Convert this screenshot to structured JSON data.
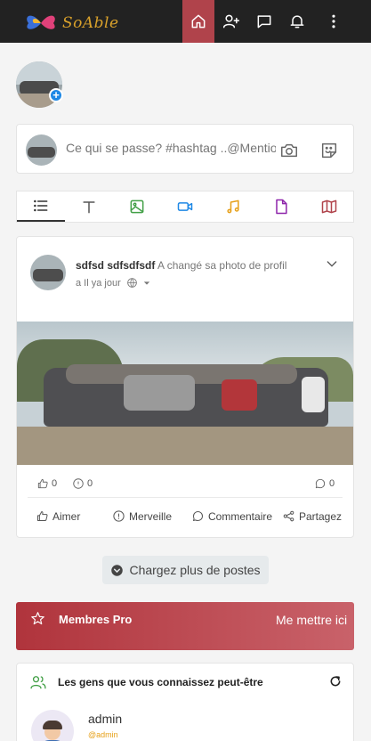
{
  "app": {
    "logo_text": "SoAble"
  },
  "composer": {
    "placeholder": "Ce qui se passe? #hashtag ..@Mentio"
  },
  "post": {
    "author": "sdfsd sdfsdfsdf",
    "action": "A changé sa photo de profil",
    "time": "a Il ya jour",
    "like_count": "0",
    "wonder_count": "0",
    "comment_count": "0",
    "like_label": "Aimer",
    "wonder_label": "Merveille",
    "comment_label": "Commentaire",
    "share_label": "Partagez"
  },
  "load_more": "Chargez plus de postes",
  "pro": {
    "title": "Membres Pro",
    "cta": "Me mettre ici"
  },
  "suggest": {
    "title": "Les gens que vous connaissez peut-être",
    "user_name": "admin",
    "user_handle": "@admin"
  },
  "colors": {
    "topbar": "#222222",
    "accent": "#b0434b",
    "load_more_bg": "#e6eaec"
  },
  "icons": [
    "home-icon",
    "add-user-icon",
    "messages-icon",
    "bell-icon",
    "more-vertical-icon",
    "camera-icon",
    "sticker-icon",
    "list-icon",
    "text-icon",
    "image-icon",
    "video-icon",
    "music-icon",
    "file-icon",
    "map-icon",
    "chevron-down-icon",
    "globe-icon",
    "like-icon",
    "wonder-icon",
    "comment-icon",
    "share-icon",
    "star-icon",
    "users-icon",
    "refresh-icon"
  ]
}
